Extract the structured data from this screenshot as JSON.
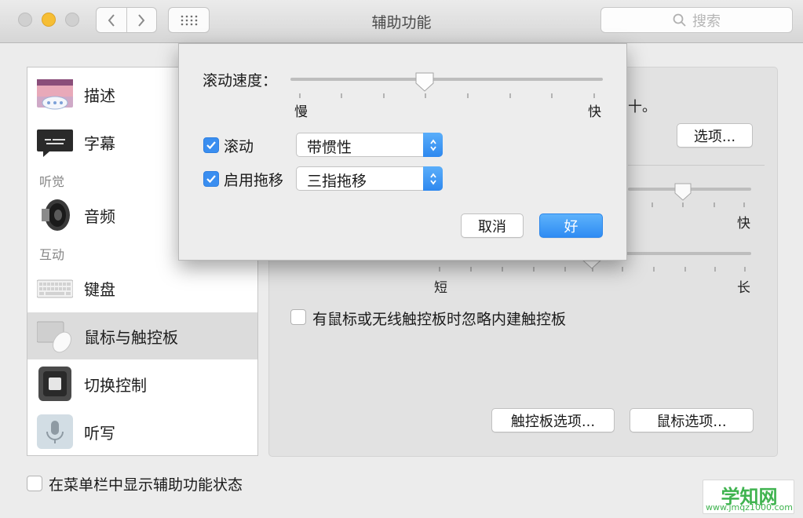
{
  "window": {
    "title": "辅助功能",
    "search_placeholder": "搜索",
    "back_icon": "chevron-left-icon",
    "forward_icon": "chevron-right-icon",
    "grid_icon": "grid-icon"
  },
  "sidebar": {
    "items": [
      {
        "label": "描述",
        "icon": "description-icon"
      },
      {
        "label": "字幕",
        "icon": "captions-icon"
      },
      {
        "label": "音频",
        "icon": "speaker-icon"
      },
      {
        "label": "键盘",
        "icon": "keyboard-icon"
      },
      {
        "label": "鼠标与触控板",
        "icon": "mouse-trackpad-icon",
        "selected": true
      },
      {
        "label": "切换控制",
        "icon": "switch-control-icon"
      },
      {
        "label": "听写",
        "icon": "microphone-icon"
      }
    ],
    "sections": {
      "hearing": "听觉",
      "interaction": "互动"
    }
  },
  "content": {
    "partial_text": "十。",
    "options_button": "选项...",
    "speed_fast_label": "快",
    "spring_short_label": "短",
    "spring_long_label": "长",
    "ignore_trackpad_label": "有鼠标或无线触控板时忽略内建触控板",
    "ignore_trackpad_checked": false,
    "trackpad_options_button": "触控板选项...",
    "mouse_options_button": "鼠标选项..."
  },
  "sheet": {
    "scroll_speed_label": "滚动速度：",
    "scroll_speed_value": 0.43,
    "slow_label": "慢",
    "fast_label": "快",
    "scrolling_label": "滚动",
    "scrolling_checked": true,
    "scrolling_mode": "带惯性",
    "dragging_label": "启用拖移",
    "dragging_checked": true,
    "dragging_mode": "三指拖移",
    "cancel_button": "取消",
    "ok_button": "好"
  },
  "footer": {
    "show_status_label": "在菜单栏中显示辅助功能状态",
    "show_status_checked": false
  },
  "watermark": {
    "title": "学知网",
    "url": "www.jmqz1000.com"
  },
  "colors": {
    "accent": "#2f8cf3",
    "checkbox": "#3a8ef0",
    "minimize": "#f6be34",
    "watermark": "#3fb34f"
  }
}
